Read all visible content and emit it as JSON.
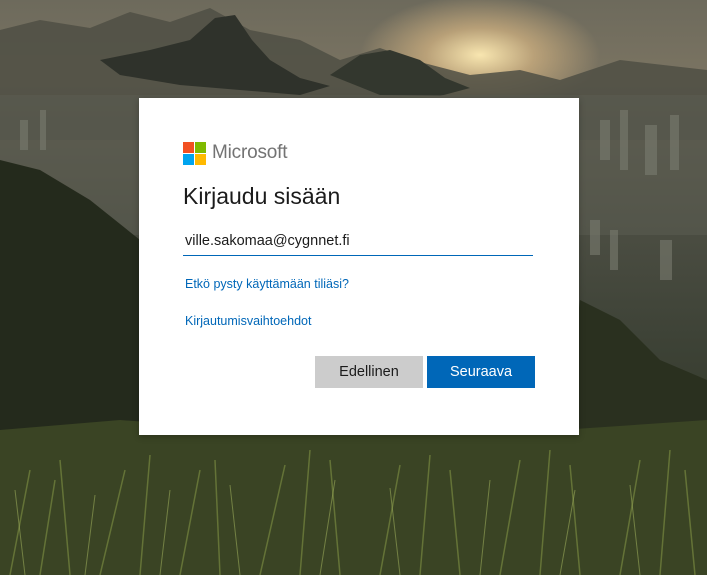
{
  "brand": {
    "name": "Microsoft",
    "logo_colors": [
      "#f25022",
      "#7fba00",
      "#00a4ef",
      "#ffb900"
    ]
  },
  "signin": {
    "title": "Kirjaudu sisään",
    "email_value": "ville.sakomaa@cygnnet.fi",
    "cant_access_link": "Etkö pysty käyttämään tiliäsi?",
    "options_link": "Kirjautumisvaihtoehdot",
    "back_label": "Edellinen",
    "next_label": "Seuraava"
  },
  "colors": {
    "accent": "#0067b8",
    "secondary_button": "#cccccc"
  }
}
